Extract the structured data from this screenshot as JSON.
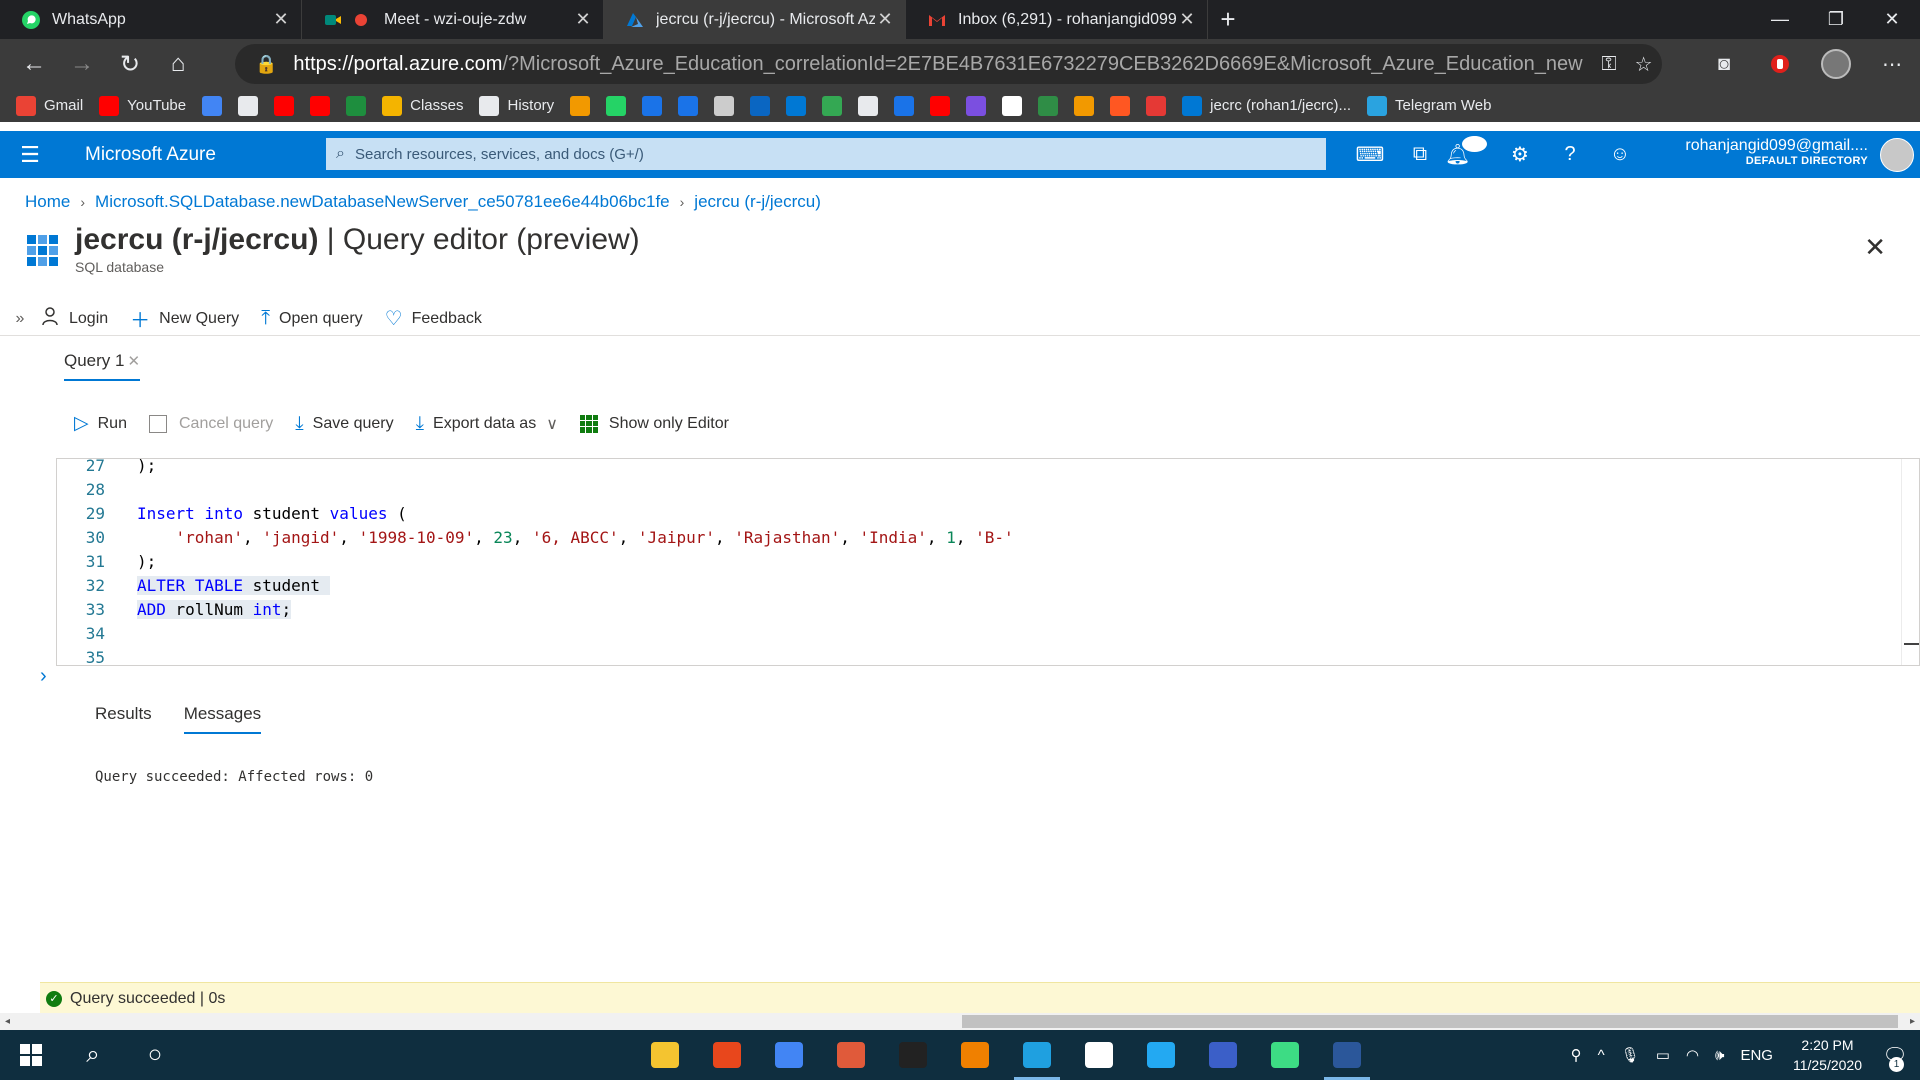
{
  "browser": {
    "tabs": [
      {
        "title": "WhatsApp",
        "icon": "whatsapp-icon",
        "color": "#25d366",
        "active": false
      },
      {
        "title": "Meet - wzi-ouje-zdw",
        "icon": "google-meet-icon",
        "color": "#00897b",
        "active": false
      },
      {
        "title": "jecrcu (r-j/jecrcu) - Microsoft Azu",
        "icon": "azure-icon",
        "color": "#0078d4",
        "active": true
      },
      {
        "title": "Inbox (6,291) - rohanjangid099@",
        "icon": "gmail-icon",
        "color": "#ea4335",
        "active": false
      }
    ],
    "url_host": "https://portal.azure.com",
    "url_rest": "/?Microsoft_Azure_Education_correlationId=2E7BE4B7631E6732279CEB3262D6669E&Microsoft_Azure_Education_new...",
    "bookmarks": [
      {
        "label": "Gmail",
        "icon": "gmail-icon",
        "color": "#ea4335"
      },
      {
        "label": "YouTube",
        "icon": "youtube-icon",
        "color": "#ff0000"
      },
      {
        "label": "",
        "icon": "translate-icon",
        "color": "#4285f4"
      },
      {
        "label": "",
        "icon": "page-icon",
        "color": "#e8eaed"
      },
      {
        "label": "",
        "icon": "youtube-icon",
        "color": "#ff0000"
      },
      {
        "label": "",
        "icon": "youtube-icon",
        "color": "#ff0000"
      },
      {
        "label": "",
        "icon": "classroom-icon",
        "color": "#1e8e3e"
      },
      {
        "label": "Classes",
        "icon": "folder-icon",
        "color": "#f4b400"
      },
      {
        "label": "History",
        "icon": "history-icon",
        "color": "#e8eaed"
      },
      {
        "label": "",
        "icon": "rocket-icon",
        "color": "#f29900"
      },
      {
        "label": "",
        "icon": "whatsapp-icon",
        "color": "#25d366"
      },
      {
        "label": "",
        "icon": "bookmark-blue-icon",
        "color": "#1a73e8"
      },
      {
        "label": "",
        "icon": "bookmark-blue-icon",
        "color": "#1a73e8"
      },
      {
        "label": "",
        "icon": "cc-icon",
        "color": "#cccccc"
      },
      {
        "label": "",
        "icon": "linkedin-icon",
        "color": "#0a66c2"
      },
      {
        "label": "",
        "icon": "onedrive-icon",
        "color": "#0078d4"
      },
      {
        "label": "",
        "icon": "google-drive-icon",
        "color": "#34a853"
      },
      {
        "label": "",
        "icon": "page-icon",
        "color": "#e8eaed"
      },
      {
        "label": "",
        "icon": "bookmark-blue-icon",
        "color": "#1a73e8"
      },
      {
        "label": "",
        "icon": "youtube-icon",
        "color": "#ff0000"
      },
      {
        "label": "",
        "icon": "bolt-icon",
        "color": "#7b4fe0"
      },
      {
        "label": "",
        "icon": "github-icon",
        "color": "#ffffff"
      },
      {
        "label": "",
        "icon": "gfg-icon",
        "color": "#2f8d46"
      },
      {
        "label": "",
        "icon": "rocket-icon",
        "color": "#f29900"
      },
      {
        "label": "",
        "icon": "m-circle-icon",
        "color": "#ff5722"
      },
      {
        "label": "",
        "icon": "m-circle-icon",
        "color": "#e53935"
      },
      {
        "label": "jecrc (rohan1/jecrc)...",
        "icon": "azure-icon",
        "color": "#0078d4"
      },
      {
        "label": "Telegram Web",
        "icon": "telegram-icon",
        "color": "#2aa3e0"
      }
    ]
  },
  "azure": {
    "brand": "Microsoft Azure",
    "search_placeholder": "Search resources, services, and docs (G+/)",
    "notifications_count": "2",
    "account_email": "rohanjangid099@gmail....",
    "account_directory": "DEFAULT DIRECTORY",
    "accent": "#0078d4"
  },
  "breadcrumb": [
    "Home",
    "Microsoft.SQLDatabase.newDatabaseNewServer_ce50781ee6e44b06bc1fe",
    "jecrcu (r-j/jecrcu)"
  ],
  "title": {
    "name": "jecrcu (r-j/jecrcu)",
    "suffix": " | Query editor (preview)",
    "subtitle": "SQL database"
  },
  "commands": {
    "login": "Login",
    "new_query": "New Query",
    "open_query": "Open query",
    "feedback": "Feedback"
  },
  "query_tab": "Query 1",
  "query_toolbar": {
    "run": "Run",
    "cancel": "Cancel query",
    "save": "Save query",
    "export": "Export data as",
    "show_editor": "Show only Editor"
  },
  "editor": {
    "lines": [
      {
        "n": "27",
        "html": ");"
      },
      {
        "n": "28",
        "html": ""
      },
      {
        "n": "29",
        "html": "<span class='kw'>Insert</span> <span class='kw'>into</span> student <span class='kw'>values</span> ("
      },
      {
        "n": "30",
        "html": "    <span class='str'>'rohan'</span>, <span class='str'>'jangid'</span>, <span class='str'>'1998-10-09'</span>, <span class='num'>23</span>, <span class='str'>'6, ABCC'</span>, <span class='str'>'Jaipur'</span>, <span class='str'>'Rajasthan'</span>, <span class='str'>'India'</span>, <span class='num'>1</span>, <span class='str'>'B-'</span>"
      },
      {
        "n": "31",
        "html": ");"
      },
      {
        "n": "32",
        "html": "<span class='sel'><span class='kw'>ALTER</span> <span class='kw'>TABLE</span> student </span>"
      },
      {
        "n": "33",
        "html": "<span class='sel'><span class='kw'>ADD</span> rollNum <span class='kw'>int</span>;</span>"
      },
      {
        "n": "34",
        "html": ""
      },
      {
        "n": "35",
        "html": ""
      }
    ]
  },
  "results": {
    "tabs": [
      "Results",
      "Messages"
    ],
    "active": "Messages",
    "message": "Query succeeded: Affected rows: 0"
  },
  "status": "Query succeeded | 0s",
  "taskbar": {
    "apps": [
      {
        "icon": "file-explorer-icon",
        "color": "#f4c430",
        "active": false
      },
      {
        "icon": "office-icon",
        "color": "#e8471c",
        "active": false
      },
      {
        "icon": "chrome-icon",
        "color": "#4285f4",
        "active": false
      },
      {
        "icon": "media-player-icon",
        "color": "#e05a3a",
        "active": false
      },
      {
        "icon": "terminal-icon",
        "color": "#222222",
        "active": false
      },
      {
        "icon": "vlc-icon",
        "color": "#f08000",
        "active": false
      },
      {
        "icon": "edge-icon",
        "color": "#1fa0e0",
        "active": true
      },
      {
        "icon": "settings-icon",
        "color": "#ffffff",
        "active": false
      },
      {
        "icon": "vscode-icon",
        "color": "#23a9f2",
        "active": false
      },
      {
        "icon": "devc-icon",
        "color": "#3b5fc8",
        "active": false
      },
      {
        "icon": "android-studio-icon",
        "color": "#3ddc84",
        "active": false
      },
      {
        "icon": "word-icon",
        "color": "#2b579a",
        "active": true
      }
    ],
    "language": "ENG",
    "time": "2:20 PM",
    "date": "11/25/2020",
    "notification_count": "1"
  }
}
